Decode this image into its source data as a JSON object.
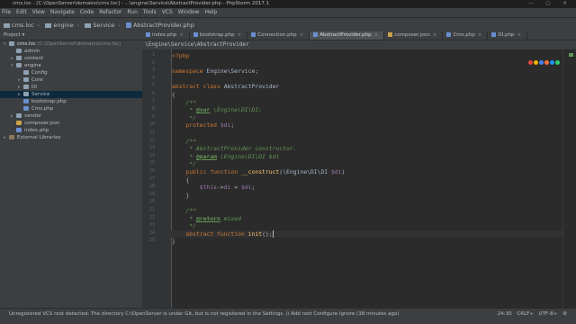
{
  "window": {
    "title": "cms.loc - [C:\\OpenServer\\domains\\cms.loc] - ...\\engine\\Service\\AbstractProvider.php - PhpStorm 2017.1"
  },
  "menu": [
    "File",
    "Edit",
    "View",
    "Navigate",
    "Code",
    "Refactor",
    "Run",
    "Tools",
    "VCS",
    "Window",
    "Help"
  ],
  "navbar": {
    "items": [
      "cms.loc",
      "engine",
      "Service",
      "AbstractProvider.php"
    ]
  },
  "project": {
    "label": "Project",
    "root": "cms.loc",
    "root_path": "(C:\\OpenServer\\domains\\cms.loc)",
    "tree": [
      {
        "label": "admin",
        "type": "folder",
        "depth": 1,
        "arrow": ""
      },
      {
        "label": "content",
        "type": "folder",
        "depth": 1,
        "arrow": "▸"
      },
      {
        "label": "engine",
        "type": "folder",
        "depth": 1,
        "arrow": "▾"
      },
      {
        "label": "Config",
        "type": "folder",
        "depth": 2,
        "arrow": ""
      },
      {
        "label": "Core",
        "type": "folder",
        "depth": 2,
        "arrow": "▸"
      },
      {
        "label": "DI",
        "type": "folder",
        "depth": 2,
        "arrow": "▸"
      },
      {
        "label": "Service",
        "type": "folder",
        "depth": 2,
        "arrow": "▸",
        "selected": true
      },
      {
        "label": "bootstrap.php",
        "type": "php",
        "depth": 2,
        "arrow": ""
      },
      {
        "label": "Cms.php",
        "type": "php",
        "depth": 2,
        "arrow": ""
      },
      {
        "label": "vendor",
        "type": "folder",
        "depth": 1,
        "arrow": "▸"
      },
      {
        "label": "composer.json",
        "type": "json",
        "depth": 1,
        "arrow": ""
      },
      {
        "label": "index.php",
        "type": "php",
        "depth": 1,
        "arrow": ""
      },
      {
        "label": "External Libraries",
        "type": "lib",
        "depth": 0,
        "arrow": "▸"
      }
    ]
  },
  "tabs": [
    {
      "label": "index.php",
      "type": "php"
    },
    {
      "label": "bootstrap.php",
      "type": "php"
    },
    {
      "label": "Connection.php",
      "type": "php"
    },
    {
      "label": "AbstractProvider.php",
      "type": "php",
      "active": true
    },
    {
      "label": "composer.json",
      "type": "json"
    },
    {
      "label": "Cms.php",
      "type": "php"
    },
    {
      "label": "DI.php",
      "type": "php"
    }
  ],
  "breadcrumb": "\\Engine\\Service\\AbstractProvider",
  "code": {
    "current_line": 24,
    "lines": [
      [
        [
          "php",
          "<?php"
        ]
      ],
      [],
      [
        [
          "kw",
          "namespace"
        ],
        [
          "plain",
          " Engine\\Service;"
        ]
      ],
      [],
      [
        [
          "kw",
          "abstract class"
        ],
        [
          "plain",
          " AbstractProvider"
        ]
      ],
      [
        [
          "plain",
          "{"
        ]
      ],
      [
        [
          "doc",
          "    /**"
        ]
      ],
      [
        [
          "doc",
          "     * "
        ],
        [
          "tag",
          "@var"
        ],
        [
          "doc",
          " \\Engine\\DI\\DI;"
        ]
      ],
      [
        [
          "doc",
          "     */"
        ]
      ],
      [
        [
          "kw",
          "    protected"
        ],
        [
          "var",
          " $di"
        ],
        [
          "plain",
          ";"
        ]
      ],
      [],
      [
        [
          "doc",
          "    /**"
        ]
      ],
      [
        [
          "doc",
          "     * AbstractProvider constructor."
        ]
      ],
      [
        [
          "doc",
          "     * "
        ],
        [
          "tag",
          "@param"
        ],
        [
          "doc",
          " \\Engine\\DI\\DI $di"
        ]
      ],
      [
        [
          "doc",
          "     */"
        ]
      ],
      [
        [
          "kw",
          "    public function"
        ],
        [
          "fn",
          " __construct"
        ],
        [
          "plain",
          "(\\Engine\\DI\\DI "
        ],
        [
          "var",
          "$di"
        ],
        [
          "plain",
          ")"
        ]
      ],
      [
        [
          "plain",
          "    {"
        ]
      ],
      [
        [
          "var",
          "        $this"
        ],
        [
          "plain",
          "->"
        ],
        [
          "var",
          "di"
        ],
        [
          "plain",
          " = "
        ],
        [
          "var",
          "$di"
        ],
        [
          "plain",
          ";"
        ]
      ],
      [
        [
          "plain",
          "    }"
        ]
      ],
      [],
      [
        [
          "doc",
          "    /**"
        ]
      ],
      [
        [
          "doc",
          "     * "
        ],
        [
          "tag",
          "@return"
        ],
        [
          "doc",
          " mixed"
        ]
      ],
      [
        [
          "doc",
          "     */"
        ]
      ],
      [
        [
          "kw",
          "    abstract function"
        ],
        [
          "fn",
          " init"
        ],
        [
          "plain",
          "();"
        ]
      ],
      [
        [
          "plain",
          "}"
        ]
      ]
    ]
  },
  "browser_colors": [
    "#e8453c",
    "#f4b400",
    "#4285f4",
    "#ff7139",
    "#1e90ff",
    "#2ecc71"
  ],
  "status": {
    "message": "Unregistered VCS root detected: The directory C:\\OpenServer is under Git, but is not registered in the Settings. // Add root  Configure  Ignore (38 minutes ago)",
    "position": "24:30",
    "line_sep": "CRLF÷",
    "encoding": "UTF-8÷",
    "extra": "⚙"
  }
}
